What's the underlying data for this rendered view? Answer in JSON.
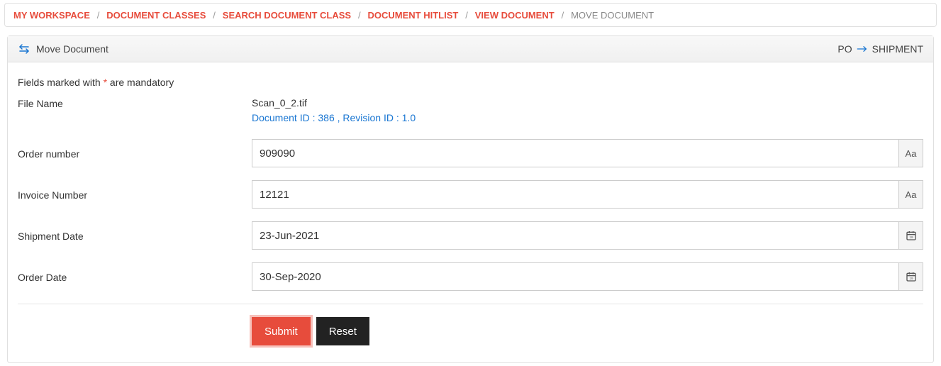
{
  "breadcrumb": {
    "items": [
      {
        "label": "MY WORKSPACE",
        "current": false
      },
      {
        "label": "DOCUMENT CLASSES",
        "current": false
      },
      {
        "label": "SEARCH DOCUMENT CLASS",
        "current": false
      },
      {
        "label": "DOCUMENT HITLIST",
        "current": false
      },
      {
        "label": "VIEW DOCUMENT",
        "current": false
      },
      {
        "label": "MOVE DOCUMENT",
        "current": true
      }
    ]
  },
  "panel": {
    "title": "Move Document",
    "from_label": "PO",
    "to_label": "SHIPMENT"
  },
  "notes": {
    "mandatory_prefix": "Fields marked with ",
    "mandatory_star": "*",
    "mandatory_suffix": " are mandatory"
  },
  "fields": {
    "file_name": {
      "label": "File Name",
      "value": "Scan_0_2.tif",
      "info": "Document ID : 386 , Revision ID : 1.0"
    },
    "order_number": {
      "label": "Order number",
      "value": "909090",
      "addon": "Aa"
    },
    "invoice_number": {
      "label": "Invoice Number",
      "value": "12121",
      "addon": "Aa"
    },
    "shipment_date": {
      "label": "Shipment Date",
      "value": "23-Jun-2021"
    },
    "order_date": {
      "label": "Order Date",
      "value": "30-Sep-2020"
    }
  },
  "buttons": {
    "submit": "Submit",
    "reset": "Reset"
  }
}
